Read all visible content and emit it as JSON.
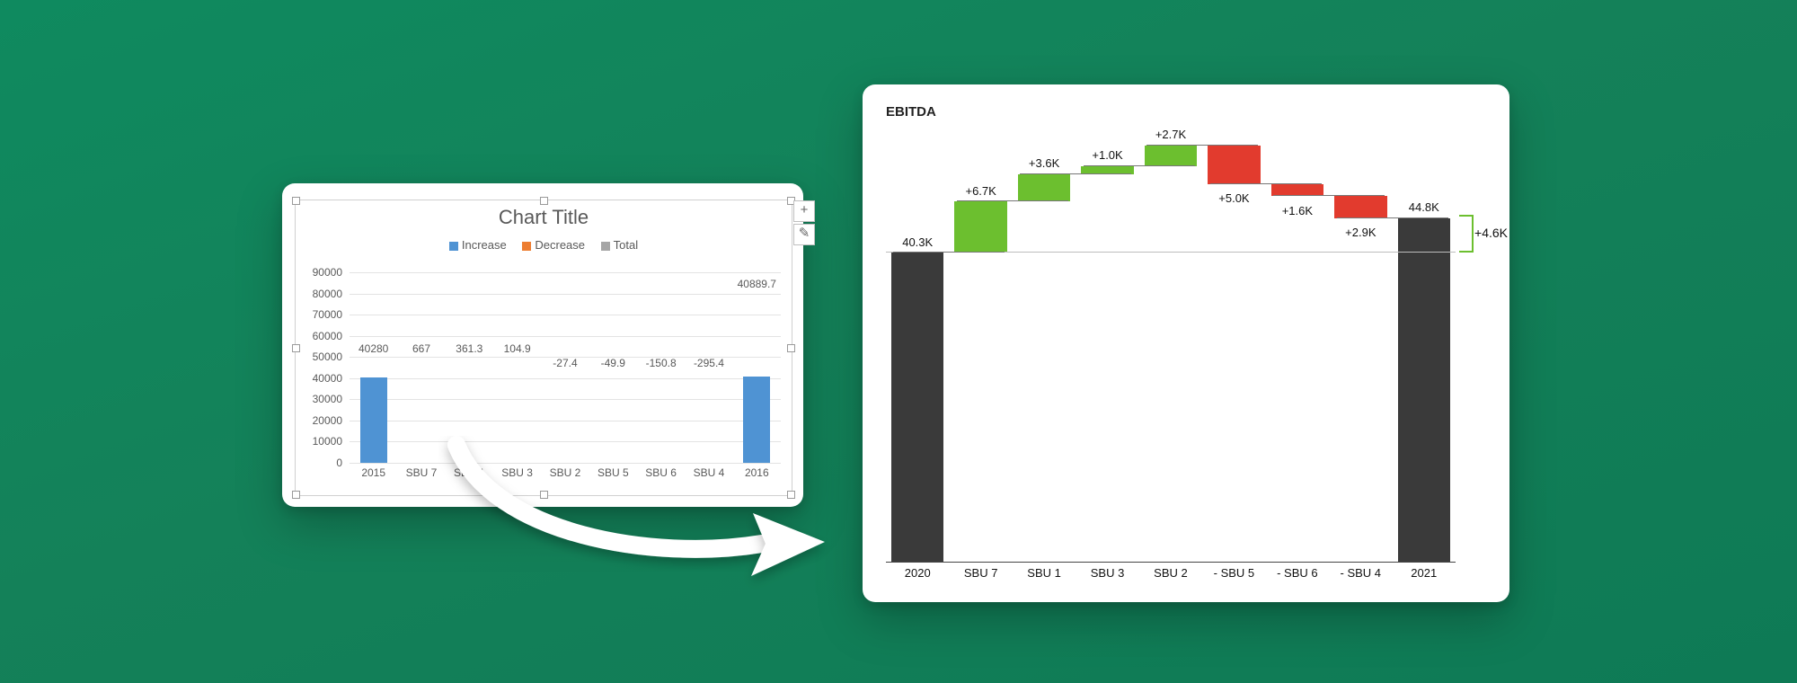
{
  "chart_data": [
    {
      "type": "waterfall",
      "title": "Chart Title",
      "legend": [
        "Increase",
        "Decrease",
        "Total"
      ],
      "y_ticks": [
        0,
        10000,
        20000,
        30000,
        40000,
        50000,
        60000,
        70000,
        80000,
        90000
      ],
      "ylim": [
        0,
        90000
      ],
      "categories": [
        "2015",
        "SBU 7",
        "SBU 1",
        "SBU 3",
        "SBU 2",
        "SBU 5",
        "SBU 6",
        "SBU 4",
        "2016"
      ],
      "values": [
        40280,
        667,
        361.3,
        104.9,
        -27.4,
        -49.9,
        -150.8,
        -295.4,
        40889.7
      ],
      "roles": [
        "total",
        "delta",
        "delta",
        "delta",
        "delta",
        "delta",
        "delta",
        "delta",
        "total"
      ]
    },
    {
      "type": "waterfall",
      "title": "EBITDA",
      "ylim": [
        0,
        55
      ],
      "categories": [
        "2020",
        "SBU 7",
        "SBU 1",
        "SBU 3",
        "SBU 2",
        "- SBU 5",
        "- SBU 6",
        "- SBU 4",
        "2021"
      ],
      "values": [
        40.3,
        6.7,
        3.6,
        1.0,
        2.7,
        -5.0,
        -1.6,
        -2.9,
        44.8
      ],
      "labels": [
        "40.3K",
        "+6.7K",
        "+3.6K",
        "+1.0K",
        "+2.7K",
        "+5.0K",
        "+1.6K",
        "+2.9K",
        "44.8K"
      ],
      "roles": [
        "total",
        "pos",
        "pos",
        "pos",
        "pos",
        "neg",
        "neg",
        "neg",
        "total"
      ],
      "diff_label": "+4.6K"
    }
  ],
  "side_buttons": {
    "plus": "+",
    "brush": "✎"
  }
}
